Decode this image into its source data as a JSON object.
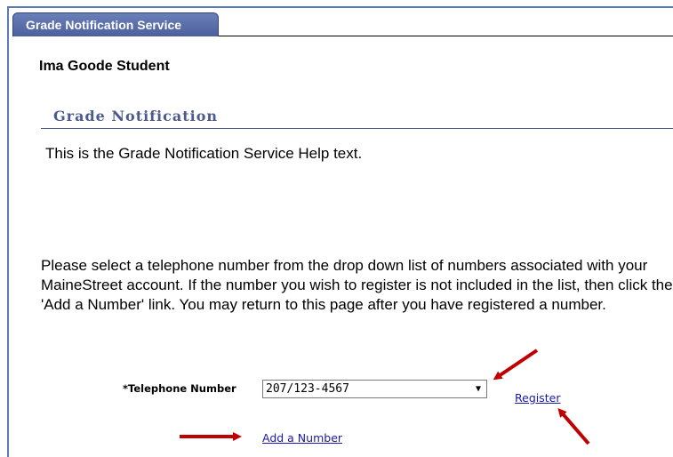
{
  "tab": {
    "label": "Grade Notification Service"
  },
  "student": {
    "name": "Ima Goode Student"
  },
  "section": {
    "title": "Grade Notification"
  },
  "help_text": "This is the Grade Notification Service Help text.",
  "instructions": "Please select a telephone number from the drop down list of numbers associated with your MaineStreet account. If the number you wish to register is not included in the list, then click the 'Add a Number' link. You may return to this page after you have registered a number.",
  "form": {
    "phone_label": "*Telephone Number",
    "phone_selected": "207/123-4567",
    "register_label": "Register",
    "add_number_label": "Add a Number"
  },
  "colors": {
    "tab_bg": "#4c609e",
    "section_title": "#4c5a8c",
    "link": "#1a1aa6",
    "annotation_arrow": "#c00000"
  },
  "icons": {
    "dropdown": "chevron-down-icon",
    "annotations": "arrow-icon"
  }
}
